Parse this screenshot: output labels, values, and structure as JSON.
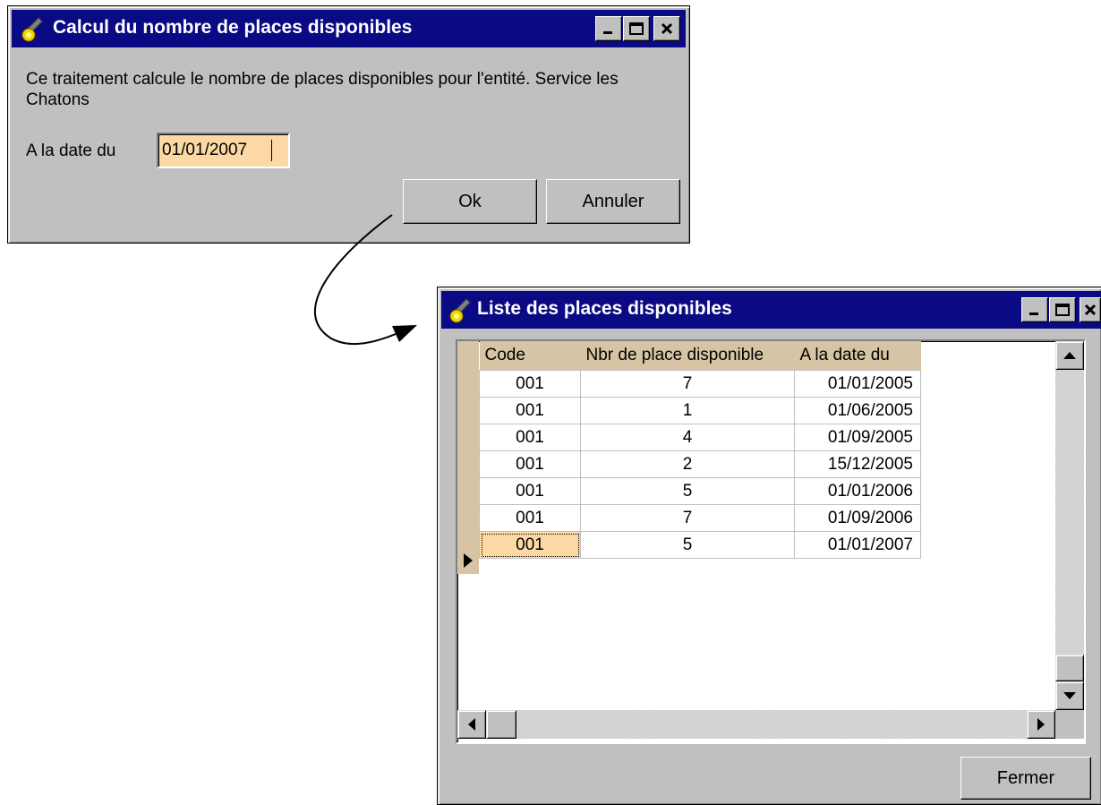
{
  "dialog1": {
    "title": "Calcul du nombre de places disponibles",
    "description": "Ce traitement calcule le nombre de places disponibles pour l'entité. Service les Chatons",
    "date_label": "A la date du",
    "date_value": "01/01/2007",
    "ok_label": "Ok",
    "cancel_label": "Annuler"
  },
  "dialog2": {
    "title": "Liste des places disponibles",
    "columns": [
      "Code",
      "Nbr de place disponible",
      "A la date du"
    ],
    "rows": [
      {
        "code": "001",
        "nbr": "7",
        "date": "01/01/2005"
      },
      {
        "code": "001",
        "nbr": "1",
        "date": "01/06/2005"
      },
      {
        "code": "001",
        "nbr": "4",
        "date": "01/09/2005"
      },
      {
        "code": "001",
        "nbr": "2",
        "date": "15/12/2005"
      },
      {
        "code": "001",
        "nbr": "5",
        "date": "01/01/2006"
      },
      {
        "code": "001",
        "nbr": "7",
        "date": "01/09/2006"
      },
      {
        "code": "001",
        "nbr": "5",
        "date": "01/01/2007"
      }
    ],
    "selected_row": 6,
    "close_label": "Fermer"
  },
  "colors": {
    "titlebar": "#0a0a84",
    "window": "#c0c0c0",
    "input_highlight": "#fcd9a4",
    "grid_header": "#d7c4a4"
  },
  "icons": [
    "app-icon",
    "minimize-icon",
    "maximize-icon",
    "close-icon",
    "scroll-up-icon",
    "scroll-down-icon",
    "scroll-left-icon",
    "scroll-right-icon",
    "row-pointer-icon",
    "curved-arrow-icon"
  ]
}
